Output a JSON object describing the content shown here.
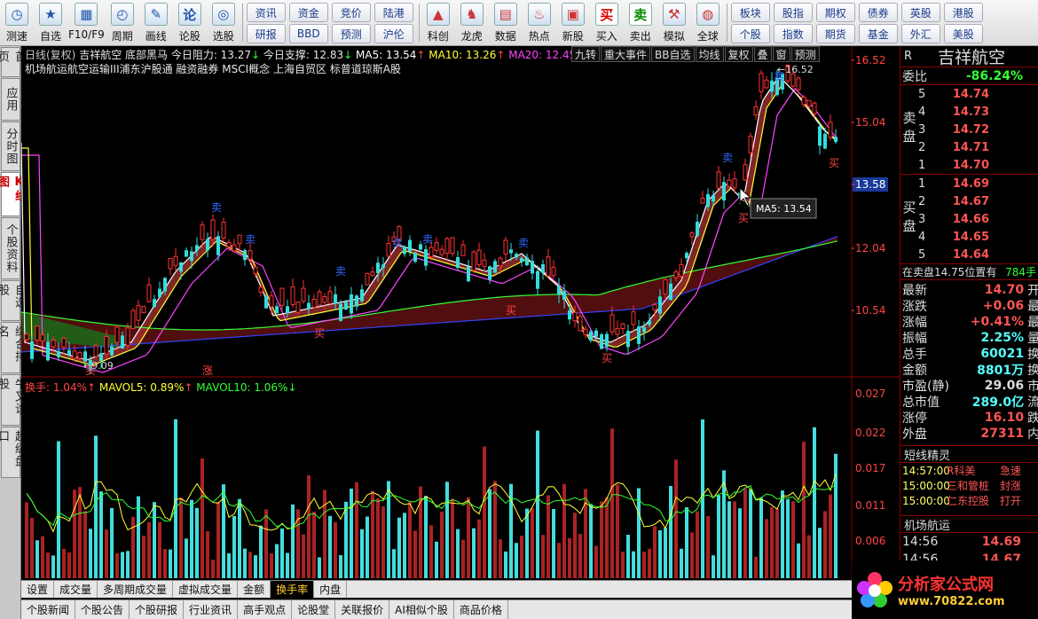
{
  "toolbar": {
    "left_buttons": [
      {
        "label": "测速",
        "icon": "speed-icon"
      },
      {
        "label": "自选",
        "icon": "star-icon"
      },
      {
        "label": "F10/F9",
        "icon": "f10-icon"
      },
      {
        "label": "周期",
        "icon": "clock-icon"
      },
      {
        "label": "画线",
        "icon": "pen-icon"
      },
      {
        "label": "论股",
        "icon": "discuss-icon"
      },
      {
        "label": "选股",
        "icon": "select-icon"
      }
    ],
    "grid1": [
      "资讯",
      "资金",
      "竞价",
      "陆港",
      "研报",
      "BBD",
      "预测",
      "沪伦"
    ],
    "mid_buttons": [
      {
        "label": "科创",
        "icon": "sci-icon"
      },
      {
        "label": "龙虎",
        "icon": "dragon-icon"
      },
      {
        "label": "数据",
        "icon": "data-icon"
      },
      {
        "label": "热点",
        "icon": "hot-icon"
      },
      {
        "label": "新股",
        "icon": "ipo-icon"
      },
      {
        "label": "买入",
        "icon": "buy-icon",
        "glyph": "买"
      },
      {
        "label": "卖出",
        "icon": "sell-icon",
        "glyph": "卖"
      },
      {
        "label": "模拟",
        "icon": "hammer-icon"
      },
      {
        "label": "全球",
        "icon": "globe-icon"
      }
    ],
    "grid2": [
      "板块",
      "股指",
      "期权",
      "债券",
      "英股",
      "港股",
      "个股",
      "指数",
      "期货",
      "基金",
      "外汇",
      "美股"
    ]
  },
  "left_tabs": [
    {
      "label": "首页",
      "active": false
    },
    {
      "label": "应用",
      "active": false
    },
    {
      "label": "分时图",
      "active": false
    },
    {
      "label": "K线图",
      "active": true
    },
    {
      "label": "个股资料",
      "active": false
    },
    {
      "label": "自选股",
      "active": false
    },
    {
      "label": "综合排名",
      "active": false
    },
    {
      "label": "牛叉诊股",
      "active": false
    },
    {
      "label": "超级盘口",
      "active": false
    }
  ],
  "chart": {
    "info_line1_parts": [
      {
        "text": "日线(复权)",
        "color": "#c8c8c8"
      },
      {
        "text": " 吉祥航空 底部黑马 今日阻力: 13.27",
        "color": "#e8e8e8"
      },
      {
        "text": "↓ ",
        "color": "#33ff33"
      },
      {
        "text": "今日支撑: 12.83",
        "color": "#e8e8e8"
      },
      {
        "text": "↓ ",
        "color": "#33ff33"
      },
      {
        "text": "MA5: 13.54",
        "color": "#ffffff"
      },
      {
        "text": "↑ ",
        "color": "#ff4444"
      },
      {
        "text": "MA10: 13.26",
        "color": "#ffff33"
      },
      {
        "text": "↑ ",
        "color": "#ff4444"
      },
      {
        "text": "MA20: 12.45",
        "color": "#ff44ff"
      },
      {
        "text": "↑ ",
        "color": "#ff4444"
      },
      {
        "text": "M",
        "color": "#33ff33"
      }
    ],
    "info_line2": "机场航运航空运输III浦东沪股通 融资融券 MSCI概念 上海自贸区 标普道琼斯A股",
    "right_buttons": [
      "九转",
      "重大事件",
      "BB自选",
      "均线",
      "复权",
      "叠",
      "窗",
      "预测"
    ],
    "price_axis": [
      "16.52",
      "15.04",
      "13.58",
      "12.04",
      "10.54"
    ],
    "current_price_tag": "13.58",
    "hi_label": "16.52",
    "lo_label": "9.09",
    "tooltip": "MA5: 13.54",
    "buy_marks": [
      "买",
      "买",
      "买",
      "买",
      "买",
      "买"
    ],
    "sell_marks": [
      "卖",
      "卖",
      "卖",
      "卖",
      "卖",
      "卖",
      "卖",
      "卖"
    ],
    "zhang_mark": "涨",
    "vol_info_parts": [
      {
        "text": "换手: 1.04%",
        "color": "#ff4444"
      },
      {
        "text": "↑ ",
        "color": "#ff4444"
      },
      {
        "text": "MAVOL5: 0.89%",
        "color": "#ffff33"
      },
      {
        "text": "↑ ",
        "color": "#ff4444"
      },
      {
        "text": "MAVOL10: 1.06%",
        "color": "#33ff33"
      },
      {
        "text": "↓",
        "color": "#33ff33"
      }
    ],
    "vol_axis": [
      "0.027",
      "0.022",
      "0.017",
      "0.011",
      "0.006"
    ]
  },
  "bottom_tabs1": [
    {
      "label": "设置",
      "active": false
    },
    {
      "label": "成交量",
      "active": false
    },
    {
      "label": "多周期成交量",
      "active": false
    },
    {
      "label": "虚拟成交量",
      "active": false
    },
    {
      "label": "金额",
      "active": false
    },
    {
      "label": "换手率",
      "active": true
    },
    {
      "label": "内盘",
      "active": false
    }
  ],
  "bottom_tabs2": [
    "个股新闻",
    "个股公告",
    "个股研报",
    "行业资讯",
    "高手观点",
    "论股堂",
    "关联报价",
    "AI相似个股",
    "商品价格"
  ],
  "quote": {
    "code": "R",
    "name": "吉祥航空",
    "weibi_label": "委比",
    "weibi_value": "-86.24%",
    "sell_label": "卖盘",
    "buy_label": "买盘",
    "sell_levels": [
      {
        "level": "5",
        "price": "14.74"
      },
      {
        "level": "4",
        "price": "14.73"
      },
      {
        "level": "3",
        "price": "14.72"
      },
      {
        "level": "2",
        "price": "14.71"
      },
      {
        "level": "1",
        "price": "14.70"
      }
    ],
    "buy_levels": [
      {
        "level": "1",
        "price": "14.69"
      },
      {
        "level": "2",
        "price": "14.67"
      },
      {
        "level": "3",
        "price": "14.66"
      },
      {
        "level": "4",
        "price": "14.65"
      },
      {
        "level": "5",
        "price": "14.64"
      }
    ],
    "pending_text": "在卖盘14.75位置有",
    "pending_vol": "784手",
    "stats": [
      {
        "k": "最新",
        "v": "14.70",
        "color": "#ff5555",
        "k2": "开"
      },
      {
        "k": "涨跌",
        "v": "+0.06",
        "color": "#ff5555",
        "k2": "最"
      },
      {
        "k": "涨幅",
        "v": "+0.41%",
        "color": "#ff5555",
        "k2": "最"
      },
      {
        "k": "振幅",
        "v": "2.25%",
        "color": "#55ffff",
        "k2": "量"
      },
      {
        "k": "总手",
        "v": "60021",
        "color": "#55ffff",
        "k2": "换"
      },
      {
        "k": "金额",
        "v": "8801万",
        "color": "#55ffff",
        "k2": "换"
      },
      {
        "k": "市盈(静)",
        "v": "29.06",
        "color": "#dddddd",
        "k2": "市"
      },
      {
        "k": "总市值",
        "v": "289.0亿",
        "color": "#55ffff",
        "k2": "流"
      },
      {
        "k": "涨停",
        "v": "16.10",
        "color": "#ff5555",
        "k2": "跌"
      },
      {
        "k": "外盘",
        "v": "27311",
        "color": "#ff5555",
        "k2": "内"
      }
    ],
    "alerts_title": "短线精灵",
    "alerts": [
      {
        "t": "14:57:00",
        "n": "R科美",
        "e": "急速"
      },
      {
        "t": "15:00:00",
        "n": "三和管桩",
        "e": "封涨"
      },
      {
        "t": "15:00:00",
        "n": "仁东控股",
        "e": "打开"
      }
    ],
    "ticks_title": "机场航运",
    "ticks": [
      {
        "t": "14:56",
        "p": "14.69"
      },
      {
        "t": "14:56",
        "p": "14.67"
      }
    ]
  },
  "logo": {
    "text": "分析家公式网",
    "url": "www.70822.com"
  },
  "colors": {
    "up": "#ff3333",
    "down": "#33dddd",
    "ma5": "#ffffff",
    "ma10": "#ffff33",
    "ma20": "#ff44ff",
    "ma60": "#33ff33",
    "ma120": "#3344ff"
  }
}
